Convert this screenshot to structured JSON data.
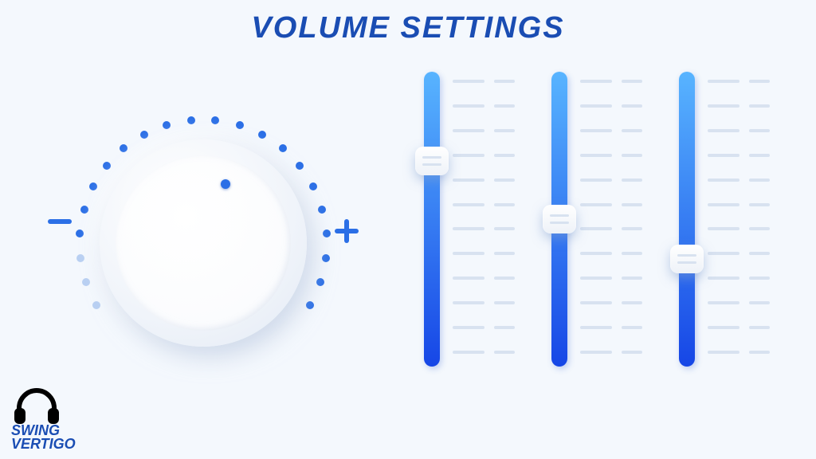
{
  "title": "VOLUME SETTINGS",
  "colors": {
    "accent": "#2b6fe6",
    "accent_light": "#58b4ff",
    "tick_faded": "#b9d0f2",
    "background": "#f4f8fd"
  },
  "knob": {
    "minus_label": "−",
    "plus_label": "+",
    "value_percent": 55,
    "tick_count": 22,
    "tick_arc_start_deg": -210,
    "tick_arc_end_deg": 30,
    "faded_tick_indices": [
      0,
      1,
      2
    ]
  },
  "sliders": [
    {
      "name": "slider-1",
      "value_percent": 72,
      "scale_rows": 12
    },
    {
      "name": "slider-2",
      "value_percent": 50,
      "scale_rows": 12
    },
    {
      "name": "slider-3",
      "value_percent": 35,
      "scale_rows": 12
    }
  ],
  "logo": {
    "line1": "SWING",
    "line2": "VERTIGO",
    "icon": "headphones-icon"
  }
}
